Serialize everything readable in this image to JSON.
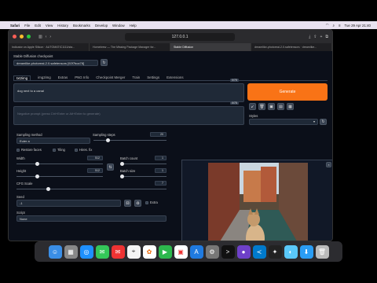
{
  "menubar": {
    "app": "Safari",
    "items": [
      "File",
      "Edit",
      "View",
      "History",
      "Bookmarks",
      "Develop",
      "Window",
      "Help"
    ],
    "clock": "Tue 29 Apr  21:40"
  },
  "browser": {
    "url": "127.0.0.1",
    "tabs": [
      "Indicator on Apple Silicon · AUTOMATIC1111/sta...",
      "Homebrew — The Missing Package Manager for...",
      "Stable Diffusion",
      "dreamlike-photoreal-2.0.safetensors · dreamlike..."
    ]
  },
  "sd": {
    "checkpoint_label": "Stable Diffusion checkpoint",
    "checkpoint_value": "dreamlike-photoreal-2.0.safetensors [92f7bca78]",
    "tabs": [
      "txt2img",
      "img2img",
      "Extras",
      "PNG Info",
      "Checkpoint Merger",
      "Train",
      "Settings",
      "Extensions"
    ],
    "prompt": "dog next to a canal",
    "prompt_counter": "0/75",
    "negative_placeholder": "Negative prompt (press Ctrl+Enter or Alt+Enter to generate)",
    "negative_counter": "0/75",
    "generate": "Generate",
    "styles_label": "Styles",
    "sampling_method_label": "Sampling method",
    "sampling_method": "Euler a",
    "sampling_steps_label": "Sampling steps",
    "sampling_steps": "20",
    "restore_faces": "Restore faces",
    "tiling": "Tiling",
    "hires_fix": "Hires. fix",
    "width_label": "Width",
    "width": "512",
    "height_label": "Height",
    "height": "512",
    "batch_count_label": "Batch count",
    "batch_count": "1",
    "batch_size_label": "Batch size",
    "batch_size": "1",
    "cfg_label": "CFG Scale",
    "cfg": "7",
    "seed_label": "Seed",
    "seed": "-1",
    "extra": "Extra",
    "script_label": "Script",
    "script": "None"
  },
  "colors": {
    "accent": "#f97316",
    "bg": "#0b0f19"
  }
}
